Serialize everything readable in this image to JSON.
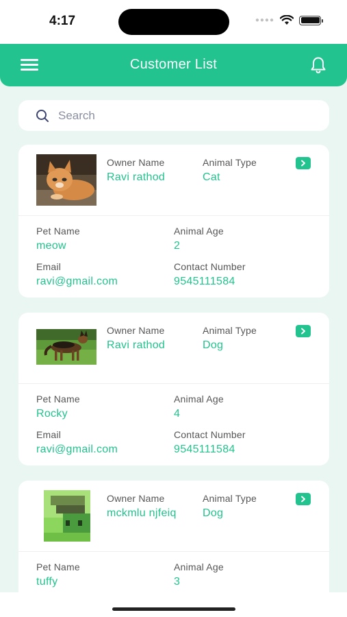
{
  "status_bar": {
    "time": "4:17"
  },
  "header": {
    "title": "Customer List"
  },
  "search": {
    "placeholder": "Search"
  },
  "labels": {
    "owner_name": "Owner Name",
    "animal_type": "Animal Type",
    "pet_name": "Pet Name",
    "animal_age": "Animal Age",
    "email": "Email",
    "contact_number": "Contact Number"
  },
  "customers": [
    {
      "owner_name": "Ravi rathod",
      "animal_type": "Cat",
      "pet_name": "meow",
      "animal_age": "2",
      "email": "ravi@gmail.com",
      "contact_number": "9545111584"
    },
    {
      "owner_name": "Ravi rathod",
      "animal_type": "Dog",
      "pet_name": "Rocky",
      "animal_age": "4",
      "email": "ravi@gmail.com",
      "contact_number": "9545111584"
    },
    {
      "owner_name": "mckmlu njfeiq",
      "animal_type": "Dog",
      "pet_name": "tuffy",
      "animal_age": "3"
    }
  ],
  "colors": {
    "accent": "#22c38e",
    "background": "#eaf6f1"
  }
}
